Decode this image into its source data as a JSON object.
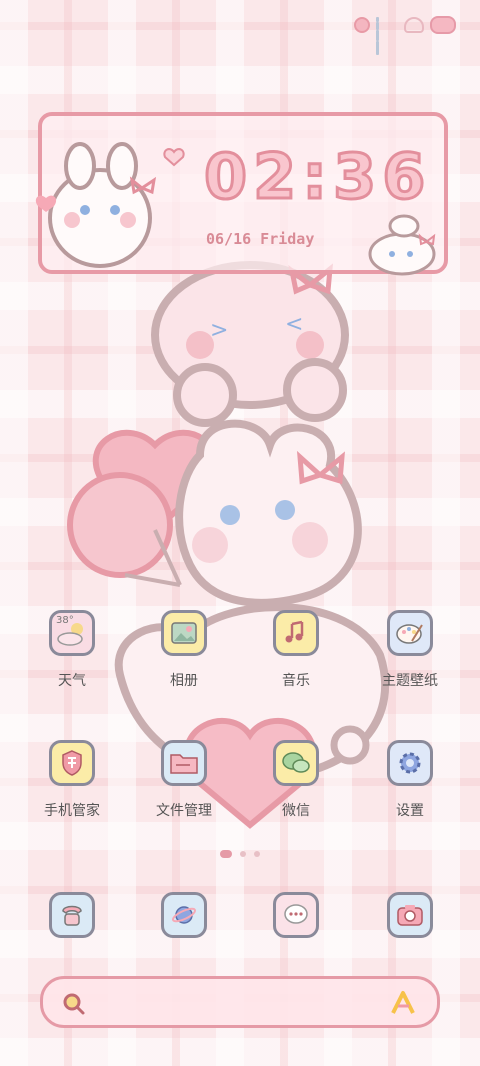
{
  "status_bar": {
    "icons": [
      "moon-icon",
      "signal-icon",
      "wifi-icon",
      "battery-icon"
    ]
  },
  "clock": {
    "time": "02:36",
    "date": "06/16 Friday"
  },
  "apps": [
    {
      "label": "天气",
      "icon": "weather-icon",
      "bg": "#f9dce4",
      "badge": "38°"
    },
    {
      "label": "相册",
      "icon": "gallery-icon",
      "bg": "#fbeca8"
    },
    {
      "label": "音乐",
      "icon": "music-icon",
      "bg": "#fbeca8"
    },
    {
      "label": "主题壁纸",
      "icon": "theme-icon",
      "bg": "#dfe8f8"
    },
    {
      "label": "手机管家",
      "icon": "shield-icon",
      "bg": "#fbeca8"
    },
    {
      "label": "文件管理",
      "icon": "folder-icon",
      "bg": "#dbeaf6"
    },
    {
      "label": "微信",
      "icon": "wechat-icon",
      "bg": "#fbeca8"
    },
    {
      "label": "设置",
      "icon": "gear-icon",
      "bg": "#dfe8f8"
    }
  ],
  "dock": [
    {
      "icon": "phone-icon",
      "bg": "#dbeaf6"
    },
    {
      "icon": "browser-icon",
      "bg": "#dbeaf6"
    },
    {
      "icon": "messages-icon",
      "bg": "#fbe2e8"
    },
    {
      "icon": "camera-icon",
      "bg": "#dbeaf6"
    }
  ],
  "page_indicator": {
    "count": 3,
    "active": 0
  },
  "search": {
    "icon": "search-icon",
    "logo": "assistant-logo-icon"
  }
}
